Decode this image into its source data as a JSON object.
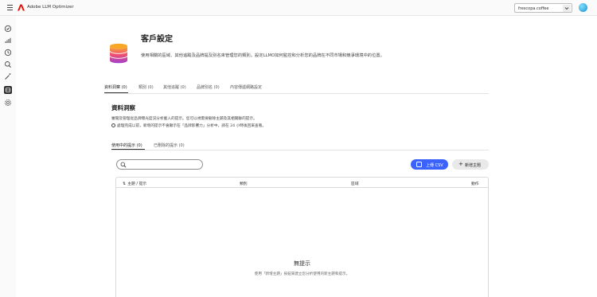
{
  "app": {
    "title": "Adobe LLM Optimizer"
  },
  "org_select": {
    "value": "frescopa.coffee"
  },
  "page": {
    "title": "客戶設定",
    "description": "使用相關的區域、其他追蹤及品牌提及別名來管理您的類別。設定LLMO如何監控和分析您的品牌在不同市場和競爭環境中的位置。"
  },
  "tabs": [
    {
      "label": "資料洞察 (0)",
      "active": true
    },
    {
      "label": "類別 (0)",
      "active": false
    },
    {
      "label": "其他追蹤 (0)",
      "active": false
    },
    {
      "label": "品牌別名 (0)",
      "active": false
    },
    {
      "label": "內容傳遞網路設定",
      "active": false
    }
  ],
  "section": {
    "title": "資料洞察",
    "description": "審閱及管理從品牌曝光度況分析載入的提示。您可以視需要刪除主題及其相關聯的提示。",
    "info": "處理完成以前，新增的提示不會顯示在「品牌影響力」分析中。請在 24 小時後回來查看。"
  },
  "subtabs": [
    {
      "label": "使用中的提示 (0)",
      "active": true
    },
    {
      "label": "已刪除的提示 (0)",
      "active": false
    }
  ],
  "toolbar": {
    "upload_label": "上傳 CSV",
    "add_label": "新增主題",
    "add_symbol": "+"
  },
  "table": {
    "sort_symbol": "⇅",
    "columns": [
      "主題 / 提示",
      "類別",
      "區域",
      "動作"
    ],
    "empty_title": "無提示",
    "empty_desc": "使用「新增主題」按鈕來建立您分析使用的新主題和提示。"
  },
  "colors": {
    "accent": "#3b63fb",
    "active_nav": "#2c2c2c",
    "adobe_red": "#eb1000"
  },
  "icons": {
    "menu": "hamburger-icon",
    "logo": "adobe-logo-icon",
    "search": "search-icon",
    "upload": "upload-icon",
    "info": "info-icon"
  }
}
